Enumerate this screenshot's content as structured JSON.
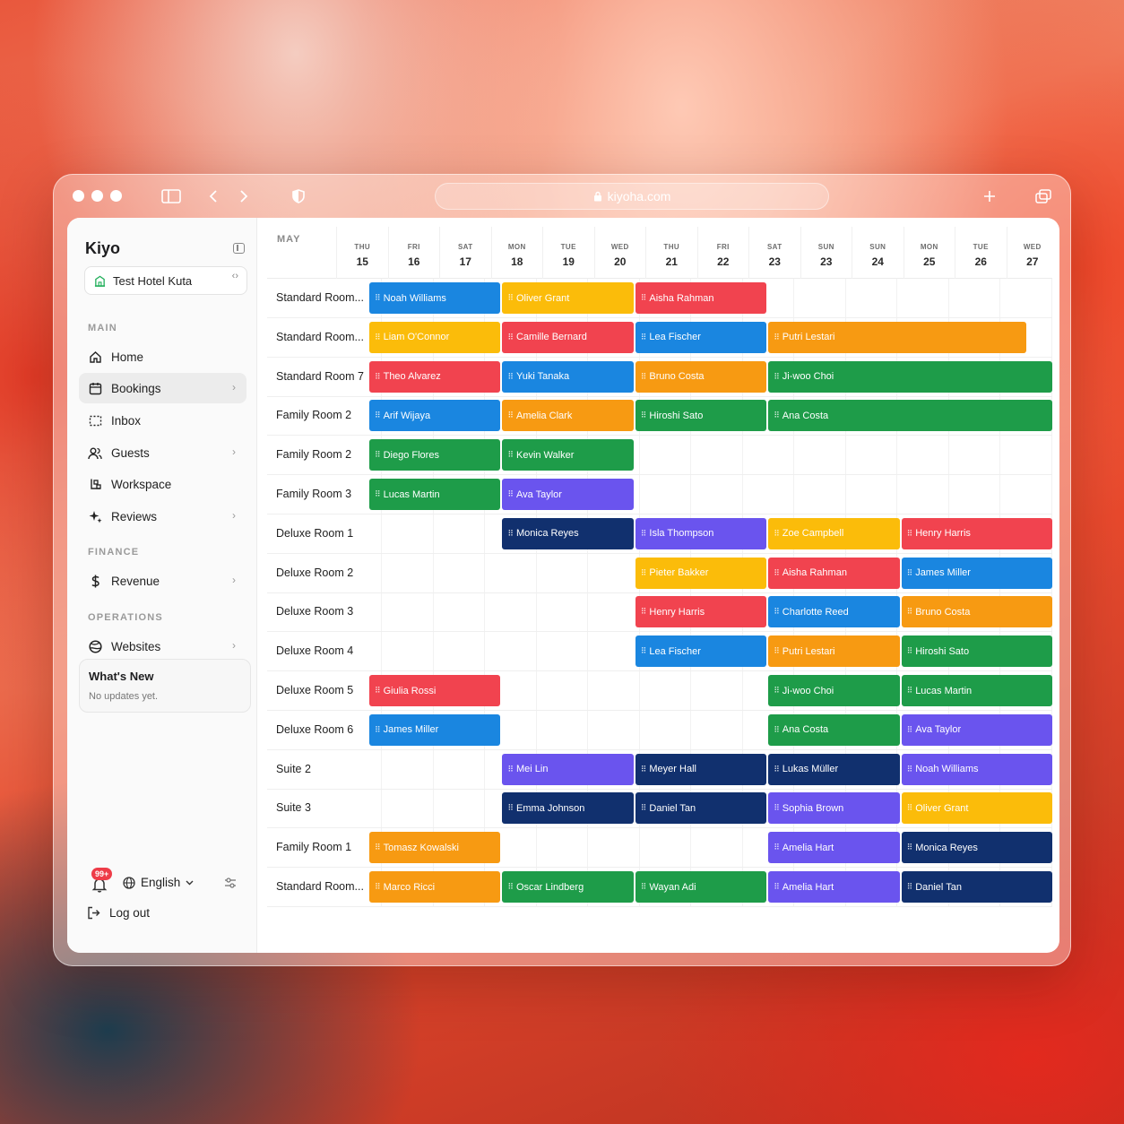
{
  "browser": {
    "url": "kiyoha.com"
  },
  "app": {
    "brand": "Kiyo",
    "hotel": "Test Hotel Kuta"
  },
  "sidebar": {
    "sections": {
      "main": "MAIN",
      "finance": "FINANCE",
      "operations": "OPERATIONS"
    },
    "items": [
      {
        "id": "home",
        "label": "Home",
        "icon": "home-icon",
        "arrow": false
      },
      {
        "id": "bookings",
        "label": "Bookings",
        "icon": "calendar-icon",
        "arrow": true,
        "active": true
      },
      {
        "id": "inbox",
        "label": "Inbox",
        "icon": "inbox-icon",
        "arrow": false
      },
      {
        "id": "guests",
        "label": "Guests",
        "icon": "users-icon",
        "arrow": true
      },
      {
        "id": "workspace",
        "label": "Workspace",
        "icon": "workspace-icon",
        "arrow": false
      },
      {
        "id": "reviews",
        "label": "Reviews",
        "icon": "sparkle-icon",
        "arrow": true
      },
      {
        "id": "revenue",
        "label": "Revenue",
        "icon": "dollar-icon",
        "arrow": true
      },
      {
        "id": "websites",
        "label": "Websites",
        "icon": "globe-icon",
        "arrow": true
      }
    ],
    "whats_new": {
      "title": "What's New",
      "subtitle": "No updates yet."
    },
    "notifications_badge": "99+",
    "language": "English",
    "logout": "Log out"
  },
  "calendar": {
    "month": "MAY",
    "days": [
      {
        "name": "THU",
        "date": "15"
      },
      {
        "name": "FRI",
        "date": "16"
      },
      {
        "name": "SAT",
        "date": "17"
      },
      {
        "name": "MON",
        "date": "18"
      },
      {
        "name": "TUE",
        "date": "19"
      },
      {
        "name": "WED",
        "date": "20"
      },
      {
        "name": "THU",
        "date": "21"
      },
      {
        "name": "FRI",
        "date": "22"
      },
      {
        "name": "SAT",
        "date": "23"
      },
      {
        "name": "SUN",
        "date": "23"
      },
      {
        "name": "SUN",
        "date": "24"
      },
      {
        "name": "MON",
        "date": "25"
      },
      {
        "name": "TUE",
        "date": "26"
      },
      {
        "name": "WED",
        "date": "27"
      }
    ],
    "colors": {
      "blue": "#1a86e0",
      "yellow": "#fbbc0a",
      "red": "#f1434f",
      "orange": "#f79a12",
      "green": "#1e9c49",
      "purple": "#6a54ee",
      "navy": "#11306e"
    },
    "rooms": [
      {
        "name": "Standard Room...",
        "bookings": [
          {
            "guest": "Noah Williams",
            "color": "blue",
            "start": 0,
            "span": 2
          },
          {
            "guest": "Oliver Grant",
            "color": "yellow",
            "start": 2,
            "span": 2
          },
          {
            "guest": "Aisha Rahman",
            "color": "red",
            "start": 4,
            "span": 2
          }
        ]
      },
      {
        "name": "Standard Room...",
        "bookings": [
          {
            "guest": "Liam O'Connor",
            "color": "yellow",
            "start": 0,
            "span": 2
          },
          {
            "guest": "Camille Bernard",
            "color": "red",
            "start": 2,
            "span": 2
          },
          {
            "guest": "Lea Fischer",
            "color": "blue",
            "start": 4,
            "span": 2
          },
          {
            "guest": "Putri Lestari",
            "color": "orange",
            "start": 6,
            "span": 3.9
          }
        ]
      },
      {
        "name": "Standard Room 7",
        "bookings": [
          {
            "guest": "Theo Alvarez",
            "color": "red",
            "start": 0,
            "span": 2
          },
          {
            "guest": "Yuki Tanaka",
            "color": "blue",
            "start": 2,
            "span": 2
          },
          {
            "guest": "Bruno Costa",
            "color": "orange",
            "start": 4,
            "span": 2
          },
          {
            "guest": "Ji-woo Choi",
            "color": "green",
            "start": 6,
            "span": 4.3
          }
        ]
      },
      {
        "name": "Family Room 2",
        "bookings": [
          {
            "guest": "Arif Wijaya",
            "color": "blue",
            "start": 0,
            "span": 2
          },
          {
            "guest": "Amelia Clark",
            "color": "orange",
            "start": 2,
            "span": 2
          },
          {
            "guest": "Hiroshi Sato",
            "color": "green",
            "start": 4,
            "span": 2
          },
          {
            "guest": "Ana Costa",
            "color": "green",
            "start": 6,
            "span": 4.3
          }
        ]
      },
      {
        "name": "Family Room 2",
        "bookings": [
          {
            "guest": "Diego Flores",
            "color": "green",
            "start": 0,
            "span": 2
          },
          {
            "guest": "Kevin Walker",
            "color": "green",
            "start": 2,
            "span": 2
          }
        ]
      },
      {
        "name": "Family Room 3",
        "bookings": [
          {
            "guest": "Lucas Martin",
            "color": "green",
            "start": 0,
            "span": 2
          },
          {
            "guest": "Ava Taylor",
            "color": "purple",
            "start": 2,
            "span": 2
          }
        ]
      },
      {
        "name": "Deluxe Room 1",
        "bookings": [
          {
            "guest": "Monica Reyes",
            "color": "navy",
            "start": 2,
            "span": 2
          },
          {
            "guest": "Isla Thompson",
            "color": "purple",
            "start": 4,
            "span": 2
          },
          {
            "guest": "Zoe Campbell",
            "color": "yellow",
            "start": 6,
            "span": 2
          },
          {
            "guest": "Henry Harris",
            "color": "red",
            "start": 8,
            "span": 2.3
          }
        ]
      },
      {
        "name": "Deluxe Room 2",
        "bookings": [
          {
            "guest": "Pieter Bakker",
            "color": "yellow",
            "start": 4,
            "span": 2
          },
          {
            "guest": "Aisha Rahman",
            "color": "red",
            "start": 6,
            "span": 2
          },
          {
            "guest": "James Miller",
            "color": "blue",
            "start": 8,
            "span": 2.3
          }
        ]
      },
      {
        "name": "Deluxe Room 3",
        "bookings": [
          {
            "guest": "Henry Harris",
            "color": "red",
            "start": 4,
            "span": 2
          },
          {
            "guest": "Charlotte Reed",
            "color": "blue",
            "start": 6,
            "span": 2
          },
          {
            "guest": "Bruno Costa",
            "color": "orange",
            "start": 8,
            "span": 2.3
          }
        ]
      },
      {
        "name": "Deluxe Room 4",
        "bookings": [
          {
            "guest": "Lea Fischer",
            "color": "blue",
            "start": 4,
            "span": 2
          },
          {
            "guest": "Putri Lestari",
            "color": "orange",
            "start": 6,
            "span": 2
          },
          {
            "guest": "Hiroshi Sato",
            "color": "green",
            "start": 8,
            "span": 2.3
          }
        ]
      },
      {
        "name": "Deluxe Room 5",
        "bookings": [
          {
            "guest": "Giulia Rossi",
            "color": "red",
            "start": 0,
            "span": 2
          },
          {
            "guest": "Ji-woo Choi",
            "color": "green",
            "start": 6,
            "span": 2
          },
          {
            "guest": "Lucas Martin",
            "color": "green",
            "start": 8,
            "span": 2.3
          }
        ]
      },
      {
        "name": "Deluxe Room 6",
        "bookings": [
          {
            "guest": "James Miller",
            "color": "blue",
            "start": 0,
            "span": 2
          },
          {
            "guest": "Ana Costa",
            "color": "green",
            "start": 6,
            "span": 2
          },
          {
            "guest": "Ava Taylor",
            "color": "purple",
            "start": 8,
            "span": 2.3
          }
        ]
      },
      {
        "name": "Suite 2",
        "bookings": [
          {
            "guest": "Mei Lin",
            "color": "purple",
            "start": 2,
            "span": 2
          },
          {
            "guest": "Meyer Hall",
            "color": "navy",
            "start": 4,
            "span": 2
          },
          {
            "guest": "Lukas Müller",
            "color": "navy",
            "start": 6,
            "span": 2
          },
          {
            "guest": "Noah Williams",
            "color": "purple",
            "start": 8,
            "span": 2.3
          }
        ]
      },
      {
        "name": "Suite 3",
        "bookings": [
          {
            "guest": "Emma Johnson",
            "color": "navy",
            "start": 2,
            "span": 2
          },
          {
            "guest": "Daniel Tan",
            "color": "navy",
            "start": 4,
            "span": 2
          },
          {
            "guest": "Sophia Brown",
            "color": "purple",
            "start": 6,
            "span": 2
          },
          {
            "guest": "Oliver Grant",
            "color": "yellow",
            "start": 8,
            "span": 2.3
          }
        ]
      },
      {
        "name": "Family Room 1",
        "bookings": [
          {
            "guest": "Tomasz Kowalski",
            "color": "orange",
            "start": 0,
            "span": 2
          },
          {
            "guest": "Amelia Hart",
            "color": "purple",
            "start": 6,
            "span": 2
          },
          {
            "guest": "Monica Reyes",
            "color": "navy",
            "start": 8,
            "span": 2.3
          }
        ]
      },
      {
        "name": "Standard Room...",
        "bookings": [
          {
            "guest": "Marco Ricci",
            "color": "orange",
            "start": 0,
            "span": 2
          },
          {
            "guest": "Oscar Lindberg",
            "color": "green",
            "start": 2,
            "span": 2
          },
          {
            "guest": "Wayan Adi",
            "color": "green",
            "start": 4,
            "span": 2
          },
          {
            "guest": "Amelia Hart",
            "color": "purple",
            "start": 6,
            "span": 2
          },
          {
            "guest": "Daniel Tan",
            "color": "navy",
            "start": 8,
            "span": 2.3
          }
        ]
      }
    ]
  }
}
